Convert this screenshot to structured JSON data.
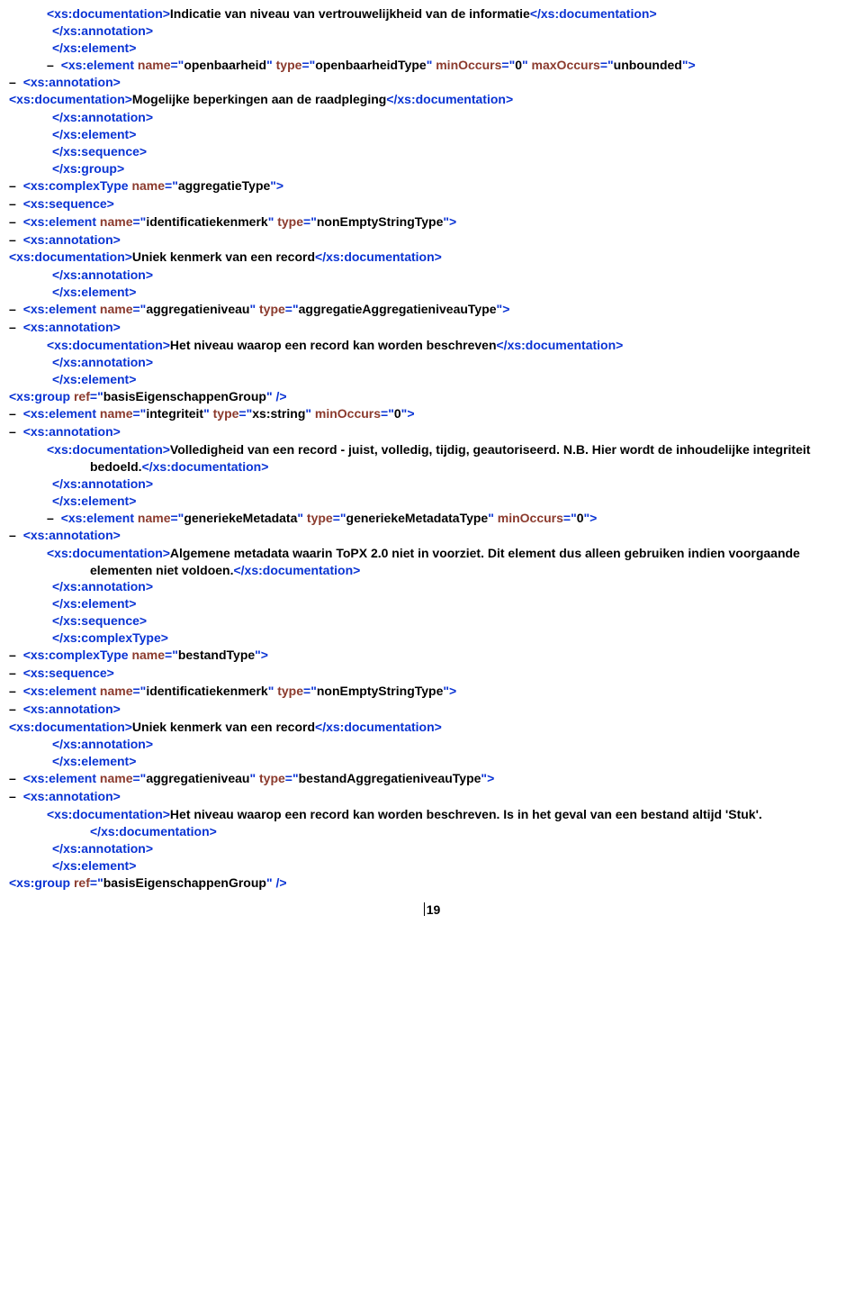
{
  "lines": [
    {
      "type": "doc",
      "pre": "<xs:documentation>",
      "text": "Indicatie van niveau van vertrouwelijkheid van de informatie",
      "post": "</xs:documentation>",
      "cls": "indent1"
    },
    {
      "type": "close",
      "text": "</xs:annotation>",
      "cls": "closing"
    },
    {
      "type": "close",
      "text": "</xs:element>",
      "cls": "closing"
    },
    {
      "type": "open",
      "dash": true,
      "parts": [
        {
          "t": "tag",
          "v": "<xs:element "
        },
        {
          "t": "attr",
          "n": "name",
          "v": "openbaarheid"
        },
        {
          "t": "sp"
        },
        {
          "t": "attr",
          "n": "type",
          "v": "openbaarheidType"
        },
        {
          "t": "sp"
        },
        {
          "t": "attr",
          "n": "minOccurs",
          "v": "0"
        },
        {
          "t": "sp"
        },
        {
          "t": "attr",
          "n": "maxOccurs",
          "v": "unbounded"
        },
        {
          "t": "tag",
          "v": ">"
        }
      ],
      "cls": "indent1"
    },
    {
      "type": "open",
      "dash": true,
      "parts": [
        {
          "t": "tag",
          "v": "<xs:annotation>"
        }
      ],
      "cls": "line"
    },
    {
      "type": "doc",
      "pre": "<xs:documentation>",
      "text": "Mogelijke beperkingen aan de raadpleging",
      "post": "</xs:documentation>",
      "cls": "line"
    },
    {
      "type": "close",
      "text": "</xs:annotation>",
      "cls": "closing"
    },
    {
      "type": "close",
      "text": "</xs:element>",
      "cls": "closing"
    },
    {
      "type": "close",
      "text": "</xs:sequence>",
      "cls": "closing"
    },
    {
      "type": "close",
      "text": "</xs:group>",
      "cls": "closing"
    },
    {
      "type": "open",
      "dash": true,
      "parts": [
        {
          "t": "tag",
          "v": "<xs:complexType "
        },
        {
          "t": "attr",
          "n": "name",
          "v": "aggregatieType"
        },
        {
          "t": "tag",
          "v": ">"
        }
      ],
      "cls": "line"
    },
    {
      "type": "open",
      "dash": true,
      "parts": [
        {
          "t": "tag",
          "v": "<xs:sequence>"
        }
      ],
      "cls": "line"
    },
    {
      "type": "open",
      "dash": true,
      "parts": [
        {
          "t": "tag",
          "v": "<xs:element "
        },
        {
          "t": "attr",
          "n": "name",
          "v": "identificatiekenmerk"
        },
        {
          "t": "sp"
        },
        {
          "t": "attr",
          "n": "type",
          "v": "nonEmptyStringType"
        },
        {
          "t": "tag",
          "v": ">"
        }
      ],
      "cls": "line"
    },
    {
      "type": "open",
      "dash": true,
      "parts": [
        {
          "t": "tag",
          "v": "<xs:annotation>"
        }
      ],
      "cls": "line"
    },
    {
      "type": "doc",
      "pre": "<xs:documentation>",
      "text": "Uniek kenmerk van een record",
      "post": "</xs:documentation>",
      "cls": "line"
    },
    {
      "type": "close",
      "text": "</xs:annotation>",
      "cls": "closing"
    },
    {
      "type": "close",
      "text": "</xs:element>",
      "cls": "closing"
    },
    {
      "type": "open",
      "dash": true,
      "parts": [
        {
          "t": "tag",
          "v": "<xs:element "
        },
        {
          "t": "attr",
          "n": "name",
          "v": "aggregatieniveau"
        },
        {
          "t": "sp"
        },
        {
          "t": "attr",
          "n": "type",
          "v": "aggregatieAggregatieniveauType"
        },
        {
          "t": "tag",
          "v": ">"
        }
      ],
      "cls": "line"
    },
    {
      "type": "open",
      "dash": true,
      "parts": [
        {
          "t": "tag",
          "v": "<xs:annotation>"
        }
      ],
      "cls": "line"
    },
    {
      "type": "doc",
      "pre": "<xs:documentation>",
      "text": "Het niveau waarop een record kan worden beschreven",
      "post": "</xs:documentation>",
      "cls": "indent1"
    },
    {
      "type": "close",
      "text": "</xs:annotation>",
      "cls": "closing"
    },
    {
      "type": "close",
      "text": "</xs:element>",
      "cls": "closing"
    },
    {
      "type": "open",
      "dash": false,
      "parts": [
        {
          "t": "tag",
          "v": "<xs:group "
        },
        {
          "t": "attrref",
          "n": "ref",
          "v": "basisEigenschappenGroup"
        },
        {
          "t": "tag",
          "v": " />"
        }
      ],
      "cls": "line"
    },
    {
      "type": "open",
      "dash": true,
      "parts": [
        {
          "t": "tag",
          "v": "<xs:element "
        },
        {
          "t": "attr",
          "n": "name",
          "v": "integriteit"
        },
        {
          "t": "sp"
        },
        {
          "t": "attr",
          "n": "type",
          "v": "xs:string"
        },
        {
          "t": "sp"
        },
        {
          "t": "attr",
          "n": "minOccurs",
          "v": "0"
        },
        {
          "t": "tag",
          "v": ">"
        }
      ],
      "cls": "line"
    },
    {
      "type": "open",
      "dash": true,
      "parts": [
        {
          "t": "tag",
          "v": "<xs:annotation>"
        }
      ],
      "cls": "line"
    },
    {
      "type": "doc",
      "pre": "<xs:documentation>",
      "text": "Volledigheid van een record - juist, volledig, tijdig, geautoriseerd. N.B. Hier wordt de inhoudelijke integriteit bedoeld.",
      "post": "</xs:documentation>",
      "cls": "indent1"
    },
    {
      "type": "close",
      "text": "</xs:annotation>",
      "cls": "closing"
    },
    {
      "type": "close",
      "text": "</xs:element>",
      "cls": "closing"
    },
    {
      "type": "open",
      "dash": true,
      "parts": [
        {
          "t": "tag",
          "v": "<xs:element "
        },
        {
          "t": "attr",
          "n": "name",
          "v": "generiekeMetadata"
        },
        {
          "t": "sp"
        },
        {
          "t": "attr",
          "n": "type",
          "v": "generiekeMetadataType"
        },
        {
          "t": "sp"
        },
        {
          "t": "attr",
          "n": "minOccurs",
          "v": "0"
        },
        {
          "t": "tag",
          "v": ">"
        }
      ],
      "cls": "indent1"
    },
    {
      "type": "open",
      "dash": true,
      "parts": [
        {
          "t": "tag",
          "v": "<xs:annotation>"
        }
      ],
      "cls": "line"
    },
    {
      "type": "doc",
      "pre": "<xs:documentation>",
      "text": "Algemene metadata waarin ToPX 2.0 niet in voorziet. Dit element dus alleen gebruiken indien voorgaande elementen niet voldoen.",
      "post": "</xs:documentation>",
      "cls": "indent1"
    },
    {
      "type": "close",
      "text": "</xs:annotation>",
      "cls": "closing"
    },
    {
      "type": "close",
      "text": "</xs:element>",
      "cls": "closing"
    },
    {
      "type": "close",
      "text": "</xs:sequence>",
      "cls": "closing"
    },
    {
      "type": "close",
      "text": "</xs:complexType>",
      "cls": "closing"
    },
    {
      "type": "open",
      "dash": true,
      "parts": [
        {
          "t": "tag",
          "v": "<xs:complexType "
        },
        {
          "t": "attr",
          "n": "name",
          "v": "bestandType"
        },
        {
          "t": "tag",
          "v": ">"
        }
      ],
      "cls": "line"
    },
    {
      "type": "open",
      "dash": true,
      "parts": [
        {
          "t": "tag",
          "v": "<xs:sequence>"
        }
      ],
      "cls": "line"
    },
    {
      "type": "open",
      "dash": true,
      "parts": [
        {
          "t": "tag",
          "v": "<xs:element "
        },
        {
          "t": "attr",
          "n": "name",
          "v": "identificatiekenmerk"
        },
        {
          "t": "sp"
        },
        {
          "t": "attr",
          "n": "type",
          "v": "nonEmptyStringType"
        },
        {
          "t": "tag",
          "v": ">"
        }
      ],
      "cls": "line"
    },
    {
      "type": "open",
      "dash": true,
      "parts": [
        {
          "t": "tag",
          "v": "<xs:annotation>"
        }
      ],
      "cls": "line"
    },
    {
      "type": "doc",
      "pre": "<xs:documentation>",
      "text": "Uniek kenmerk van een record",
      "post": "</xs:documentation>",
      "cls": "line"
    },
    {
      "type": "close",
      "text": "</xs:annotation>",
      "cls": "closing"
    },
    {
      "type": "close",
      "text": "</xs:element>",
      "cls": "closing"
    },
    {
      "type": "open",
      "dash": true,
      "parts": [
        {
          "t": "tag",
          "v": "<xs:element "
        },
        {
          "t": "attr",
          "n": "name",
          "v": "aggregatieniveau"
        },
        {
          "t": "sp"
        },
        {
          "t": "attr",
          "n": "type",
          "v": "bestandAggregatieniveauType"
        },
        {
          "t": "tag",
          "v": ">"
        }
      ],
      "cls": "line"
    },
    {
      "type": "open",
      "dash": true,
      "parts": [
        {
          "t": "tag",
          "v": "<xs:annotation>"
        }
      ],
      "cls": "line"
    },
    {
      "type": "doc",
      "pre": "<xs:documentation>",
      "text": "Het niveau waarop een record kan worden beschreven. Is in het geval van een bestand altijd 'Stuk'.",
      "post": "</xs:documentation>",
      "cls": "indent1"
    },
    {
      "type": "close",
      "text": "</xs:annotation>",
      "cls": "closing"
    },
    {
      "type": "close",
      "text": "</xs:element>",
      "cls": "closing"
    },
    {
      "type": "open",
      "dash": false,
      "parts": [
        {
          "t": "tag",
          "v": "<xs:group "
        },
        {
          "t": "attrref",
          "n": "ref",
          "v": "basisEigenschappenGroup"
        },
        {
          "t": "tag",
          "v": " />"
        }
      ],
      "cls": "line"
    }
  ],
  "pagenum": "19"
}
